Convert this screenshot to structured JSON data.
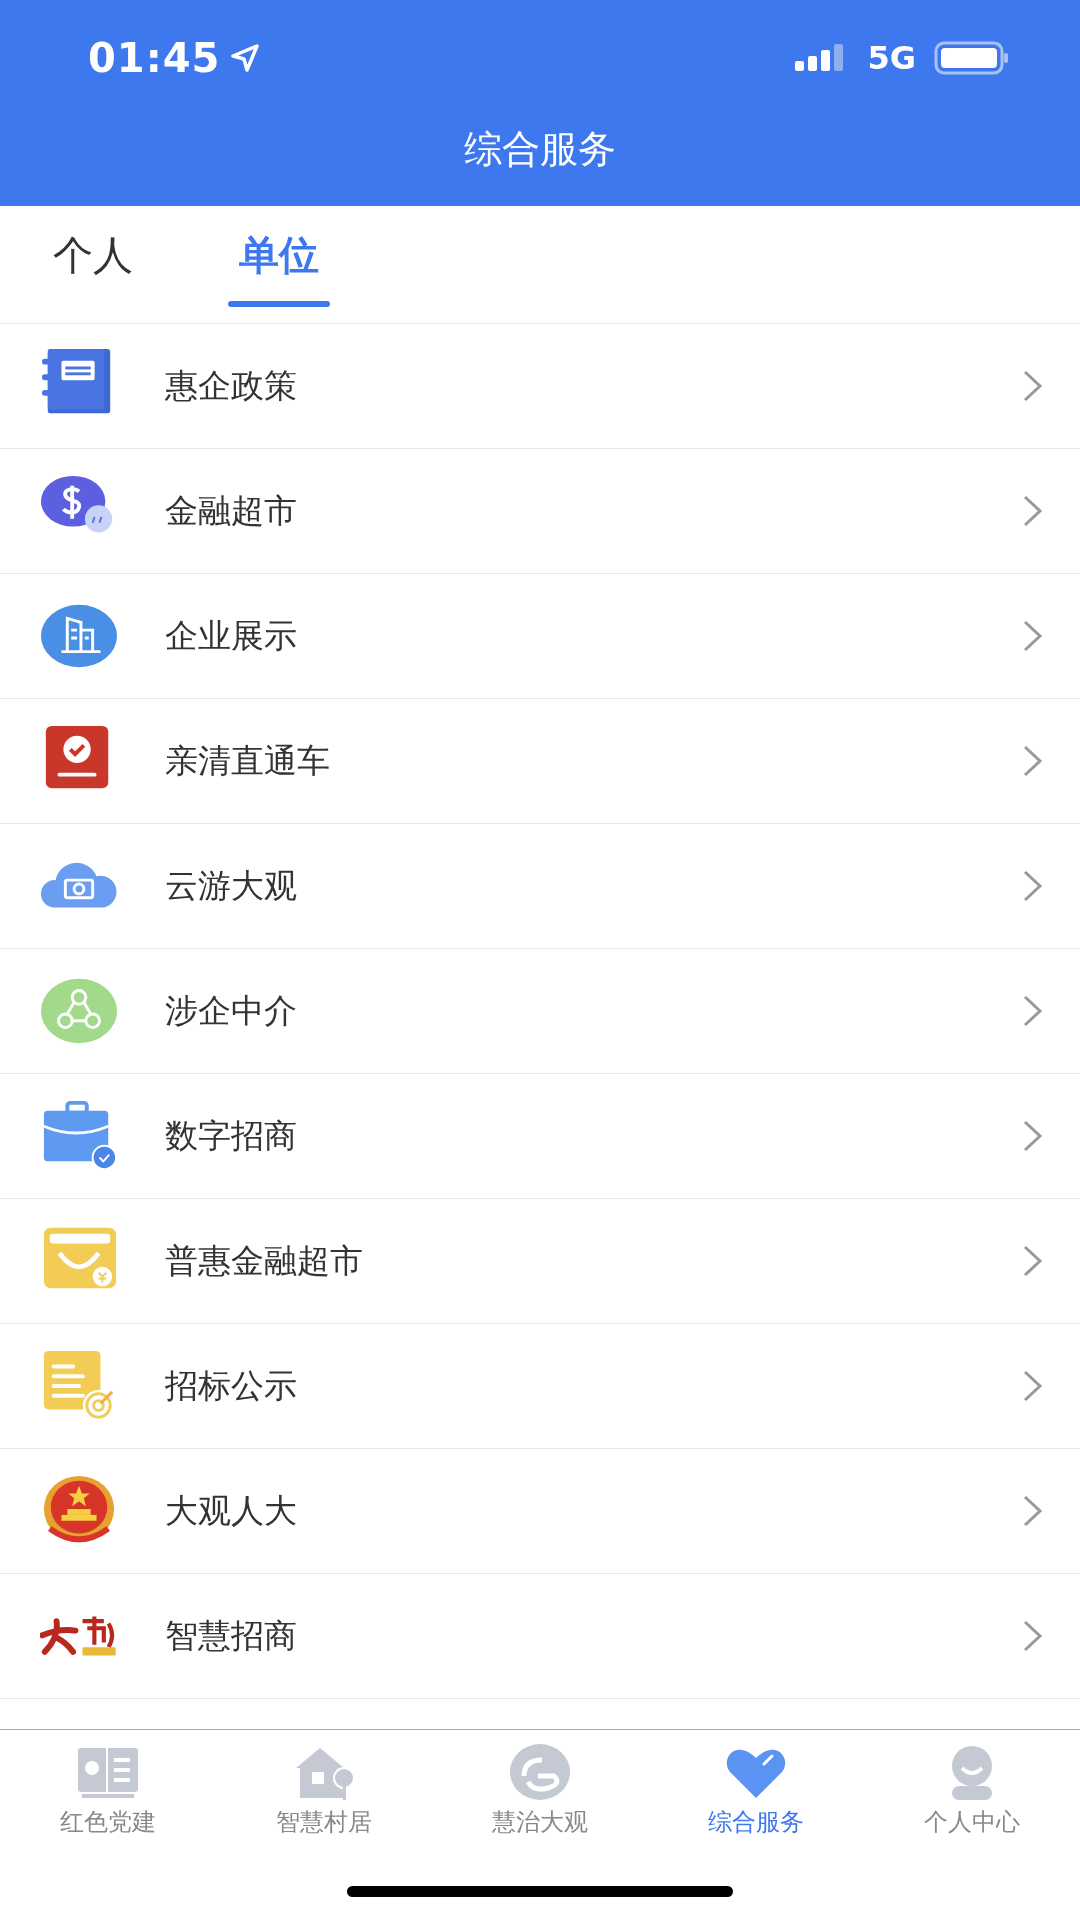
{
  "status_bar": {
    "time": "01:45",
    "network": "5G"
  },
  "header": {
    "title": "综合服务"
  },
  "tabs": [
    {
      "label": "个人",
      "selected": false
    },
    {
      "label": "单位",
      "selected": true
    }
  ],
  "rows": [
    {
      "label": "惠企政策"
    },
    {
      "label": "金融超市"
    },
    {
      "label": "企业展示"
    },
    {
      "label": "亲清直通车"
    },
    {
      "label": "云游大观"
    },
    {
      "label": "涉企中介"
    },
    {
      "label": "数字招商"
    },
    {
      "label": "普惠金融超市"
    },
    {
      "label": "招标公示"
    },
    {
      "label": "大观人大"
    },
    {
      "label": "智慧招商"
    }
  ],
  "bottom_nav": [
    {
      "label": "红色党建",
      "selected": false
    },
    {
      "label": "智慧村居",
      "selected": false
    },
    {
      "label": "慧治大观",
      "selected": false
    },
    {
      "label": "综合服务",
      "selected": true
    },
    {
      "label": "个人中心",
      "selected": false
    }
  ]
}
